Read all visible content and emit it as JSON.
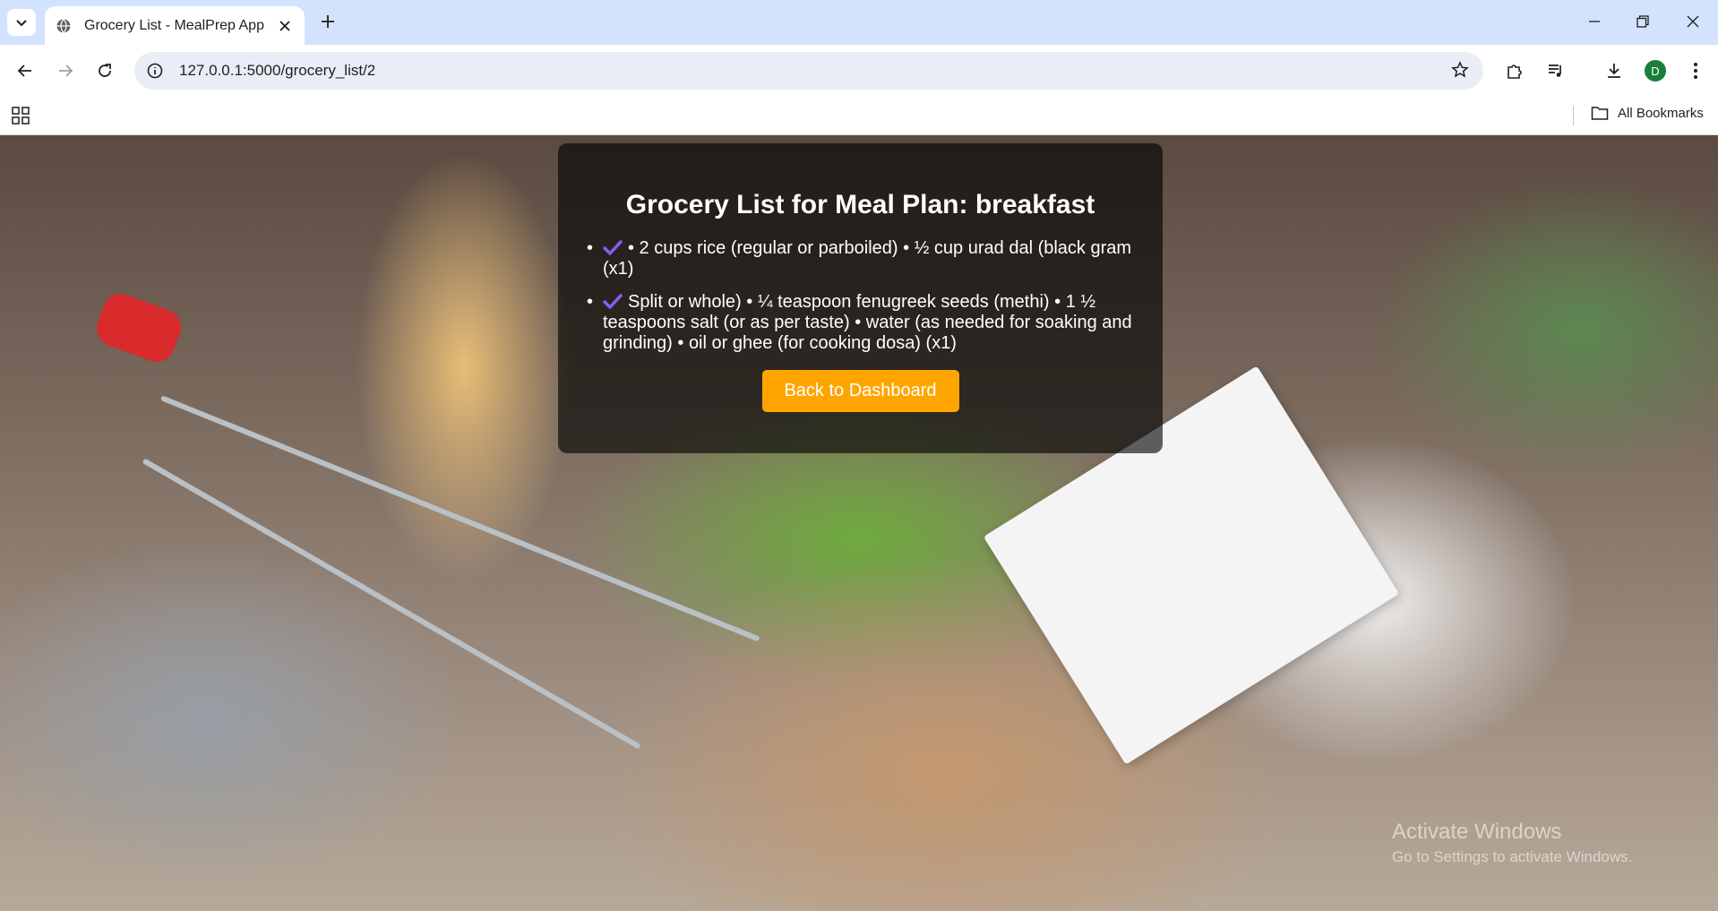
{
  "browser": {
    "tab_title": "Grocery List - MealPrep App",
    "url": "127.0.0.1:5000/grocery_list/2",
    "profile_initial": "D",
    "bookmarks_label": "All Bookmarks"
  },
  "page": {
    "title": "Grocery List for Meal Plan: breakfast",
    "items": [
      {
        "bullet": "•",
        "text": "• 2 cups rice (regular or parboiled) • ½ cup urad dal (black gram (x1)"
      },
      {
        "bullet": "•",
        "text": "Split or whole) • ¼ teaspoon fenugreek seeds (methi) • 1 ½ teaspoons salt (or as per taste) • water (as needed for soaking and grinding) • oil or ghee (for cooking dosa) (x1)"
      }
    ],
    "back_button": "Back to Dashboard"
  },
  "watermark": {
    "title": "Activate Windows",
    "subtitle": "Go to Settings to activate Windows."
  },
  "colors": {
    "button": "#ffa500",
    "check": "#8a5cf6",
    "tabbar": "#d3e3fd"
  },
  "icons": [
    "tab-search-icon",
    "globe-icon",
    "close-icon",
    "plus-icon",
    "minimize-icon",
    "restore-icon",
    "close-window-icon",
    "back-icon",
    "forward-icon",
    "reload-icon",
    "site-info-icon",
    "star-icon",
    "extensions-icon",
    "media-icon",
    "download-icon",
    "menu-icon",
    "apps-icon",
    "folder-icon",
    "check-icon"
  ]
}
